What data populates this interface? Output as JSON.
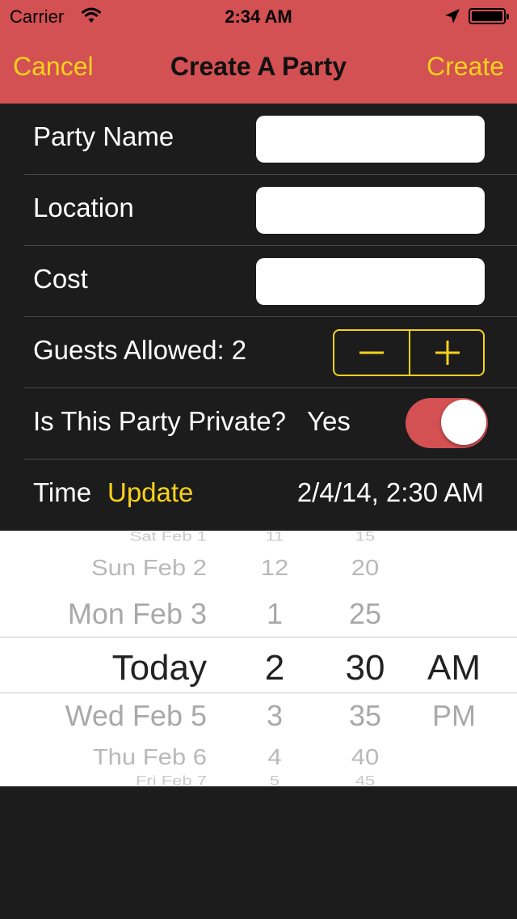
{
  "status_bar": {
    "carrier": "Carrier",
    "time": "2:34 AM"
  },
  "nav": {
    "cancel": "Cancel",
    "title": "Create A Party",
    "create": "Create"
  },
  "form": {
    "party_name_label": "Party Name",
    "party_name_value": "",
    "location_label": "Location",
    "location_value": "",
    "cost_label": "Cost",
    "cost_value": "",
    "guests_label": "Guests Allowed: 2",
    "private_label": "Is This Party Private?",
    "private_value": "Yes",
    "private_on": true,
    "time_label": "Time",
    "time_update": "Update",
    "time_value": "2/4/14, 2:30 AM"
  },
  "picker": {
    "dates": [
      "Sat Feb 1",
      "Sun Feb 2",
      "Mon Feb 3",
      "Today",
      "Wed Feb 5",
      "Thu Feb 6",
      "Fri Feb 7"
    ],
    "hours": [
      "11",
      "12",
      "1",
      "2",
      "3",
      "4",
      "5"
    ],
    "minutes": [
      "15",
      "20",
      "25",
      "30",
      "35",
      "40",
      "45"
    ],
    "ampm": [
      "",
      "",
      "",
      "AM",
      "PM",
      "",
      ""
    ]
  },
  "colors": {
    "header": "#d35053",
    "accent": "#f7d21a",
    "background": "#1c1c1c"
  },
  "icons": [
    "wifi-icon",
    "location-arrow-icon",
    "battery-icon",
    "minus-icon",
    "plus-icon"
  ]
}
